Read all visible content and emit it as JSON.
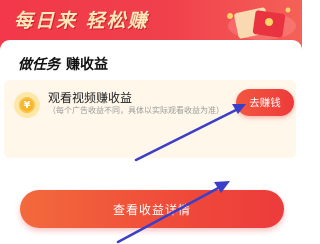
{
  "banner": {
    "title": "每日来 轻松赚"
  },
  "section": {
    "title_part1": "做任务",
    "title_part2": "赚收益"
  },
  "task": {
    "title": "观看视频赚收益",
    "description": "（每个广告收益不同，具体以实际观看收益为准）",
    "button_label": "去赚钱",
    "coin_symbol": "¥"
  },
  "footer": {
    "details_button_label": "查看收益详情"
  },
  "colors": {
    "brand_red": "#f0404c",
    "accent_orange": "#f26a3c",
    "annotation_arrow": "#3a3fc9"
  },
  "icons": {
    "coin": "coin-icon",
    "gift": "red-envelope-gift-icon",
    "arrows": "annotation-arrow-icon"
  }
}
